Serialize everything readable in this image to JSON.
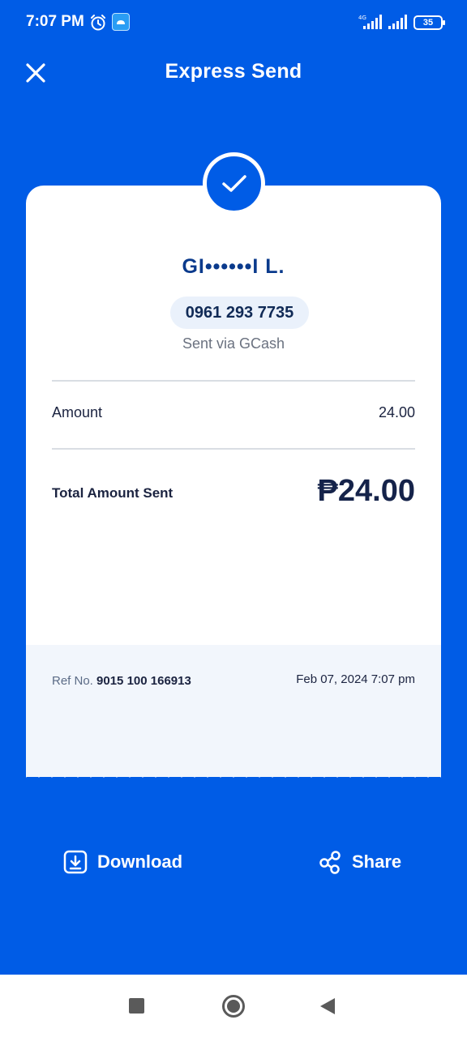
{
  "status_bar": {
    "time": "7:07 PM",
    "network": "4G",
    "battery": "35",
    "icons": [
      "alarm-icon",
      "app-badge-icon",
      "signal-icon",
      "battery-icon"
    ]
  },
  "header": {
    "title": "Express Send",
    "close_icon": "close-icon"
  },
  "receipt": {
    "recipient_name": "GI••••••I L.",
    "recipient_number": "0961 293 7735",
    "sent_via": "Sent via GCash",
    "amount_label": "Amount",
    "amount_value": "24.00",
    "total_label": "Total Amount Sent",
    "total_value": "₱24.00",
    "ref_label": "Ref No.",
    "ref_number": "9015 100 166913",
    "date": "Feb 07, 2024 7:07 pm"
  },
  "actions": {
    "download_label": "Download",
    "share_label": "Share"
  },
  "colors": {
    "brand_blue": "#005ce6",
    "name_blue": "#0a3a8c",
    "card": "#ffffff",
    "ref_bg": "#f2f6fc"
  }
}
